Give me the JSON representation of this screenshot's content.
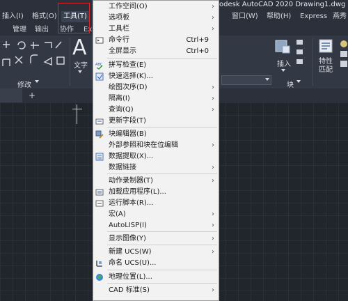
{
  "menubar": {
    "items": [
      "插入(I)",
      "格式(O)",
      "工具(T)",
      "窗口(W)",
      "帮助(H)",
      "Express",
      "燕秀"
    ],
    "title": "odesk AutoCAD 2020   Drawing1.dwg"
  },
  "ribbon_tabs": [
    "管理",
    "输出",
    "协作",
    "Exp"
  ],
  "ribbon": {
    "text_label": "文字",
    "modify_panel": "修改",
    "insert_label": "插入",
    "block_panel": "块",
    "properties_label": "特性\n匹配",
    "text_glyph": "A"
  },
  "filetab": {
    "add": "+"
  },
  "dropdown": {
    "items": [
      {
        "label": "工作空间(O)",
        "shortcut": "",
        "submenu": true,
        "icon": ""
      },
      {
        "label": "选项板",
        "shortcut": "",
        "submenu": true,
        "icon": ""
      },
      {
        "label": "工具栏",
        "shortcut": "",
        "submenu": true,
        "icon": ""
      },
      {
        "label": "命令行",
        "shortcut": "Ctrl+9",
        "submenu": false,
        "icon": "command-line-icon"
      },
      {
        "label": "全屏显示",
        "shortcut": "Ctrl+0",
        "submenu": false,
        "icon": ""
      },
      {
        "label": "拼写检查(E)",
        "shortcut": "",
        "submenu": false,
        "icon": "spell-check-icon"
      },
      {
        "label": "快速选择(K)...",
        "shortcut": "",
        "submenu": false,
        "icon": "quick-select-icon"
      },
      {
        "label": "绘图次序(D)",
        "shortcut": "",
        "submenu": true,
        "icon": ""
      },
      {
        "label": "隔离(I)",
        "shortcut": "",
        "submenu": true,
        "icon": ""
      },
      {
        "label": "查询(Q)",
        "shortcut": "",
        "submenu": true,
        "icon": ""
      },
      {
        "label": "更新字段(T)",
        "shortcut": "",
        "submenu": false,
        "icon": "update-field-icon"
      },
      {
        "label": "块编辑器(B)",
        "shortcut": "",
        "submenu": false,
        "icon": "block-editor-icon"
      },
      {
        "label": "外部参照和块在位编辑",
        "shortcut": "",
        "submenu": true,
        "icon": ""
      },
      {
        "label": "数据提取(X)...",
        "shortcut": "",
        "submenu": false,
        "icon": "data-extraction-icon"
      },
      {
        "label": "数据链接",
        "shortcut": "",
        "submenu": true,
        "icon": ""
      },
      {
        "label": "动作录制器(T)",
        "shortcut": "",
        "submenu": true,
        "icon": ""
      },
      {
        "label": "加载应用程序(L)...",
        "shortcut": "",
        "submenu": false,
        "icon": "load-application-icon"
      },
      {
        "label": "运行脚本(R)...",
        "shortcut": "",
        "submenu": false,
        "icon": "run-script-icon"
      },
      {
        "label": "宏(A)",
        "shortcut": "",
        "submenu": true,
        "icon": ""
      },
      {
        "label": "AutoLISP(I)",
        "shortcut": "",
        "submenu": true,
        "icon": ""
      },
      {
        "label": "显示图像(Y)",
        "shortcut": "",
        "submenu": true,
        "icon": ""
      },
      {
        "label": "新建 UCS(W)",
        "shortcut": "",
        "submenu": true,
        "icon": ""
      },
      {
        "label": "命名 UCS(U)...",
        "shortcut": "",
        "submenu": false,
        "icon": "named-ucs-icon"
      },
      {
        "label": "地理位置(L)...",
        "shortcut": "",
        "submenu": false,
        "icon": "geolocation-icon"
      },
      {
        "label": "CAD 标准(S)",
        "shortcut": "",
        "submenu": true,
        "icon": ""
      }
    ]
  }
}
